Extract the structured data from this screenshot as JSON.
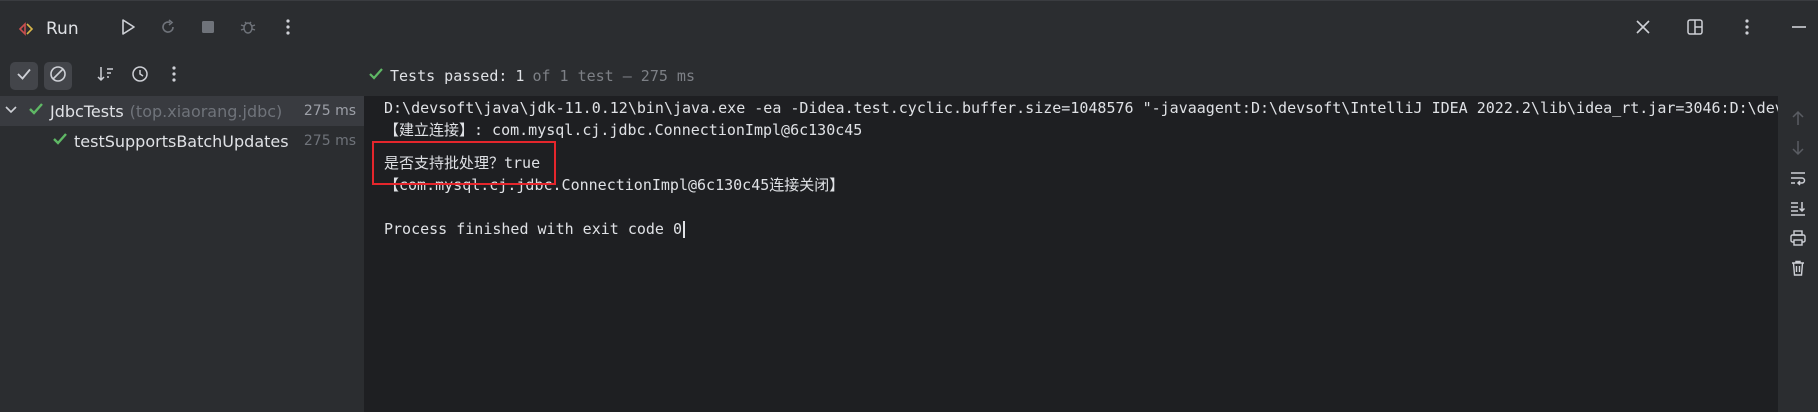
{
  "window": {
    "run_label": "Run"
  },
  "status": {
    "label": "Tests passed:",
    "count": "1",
    "rest": "of 1 test – 275 ms"
  },
  "tree": [
    {
      "name": "JdbcTests",
      "pkg": "(top.xiaorang.jdbc)",
      "ms": "275 ms",
      "expanded": true
    },
    {
      "name": "testSupportsBatchUpdates",
      "ms": "275 ms"
    }
  ],
  "console": {
    "lines": [
      "D:\\devsoft\\java\\jdk-11.0.12\\bin\\java.exe -ea -Didea.test.cyclic.buffer.size=1048576 \"-javaagent:D:\\devsoft\\IntelliJ IDEA 2022.2\\lib\\idea_rt.jar=3046:D:\\dev",
      "【建立连接】: com.mysql.cj.jdbc.ConnectionImpl@6c130c45",
      "是否支持批处理？true",
      "【com.mysql.cj.jdbc.ConnectionImpl@6c130c45连接关闭】",
      "",
      "Process finished with exit code 0"
    ]
  },
  "colors": {
    "pass_green": "#5fb865",
    "highlight_red": "#e5262c"
  },
  "icons": [
    "run-config-icon",
    "play-icon",
    "rerun-icon",
    "stop-icon",
    "debug-icon",
    "more-vertical-icon",
    "close-icon",
    "layout-icon",
    "minimize-icon",
    "show-passed-icon",
    "show-ignored-icon",
    "sort-icon",
    "history-icon",
    "check-icon",
    "chevron-down-icon",
    "scroll-up-icon",
    "scroll-down-icon",
    "soft-wrap-icon",
    "scroll-to-end-icon",
    "print-icon",
    "trash-icon"
  ]
}
